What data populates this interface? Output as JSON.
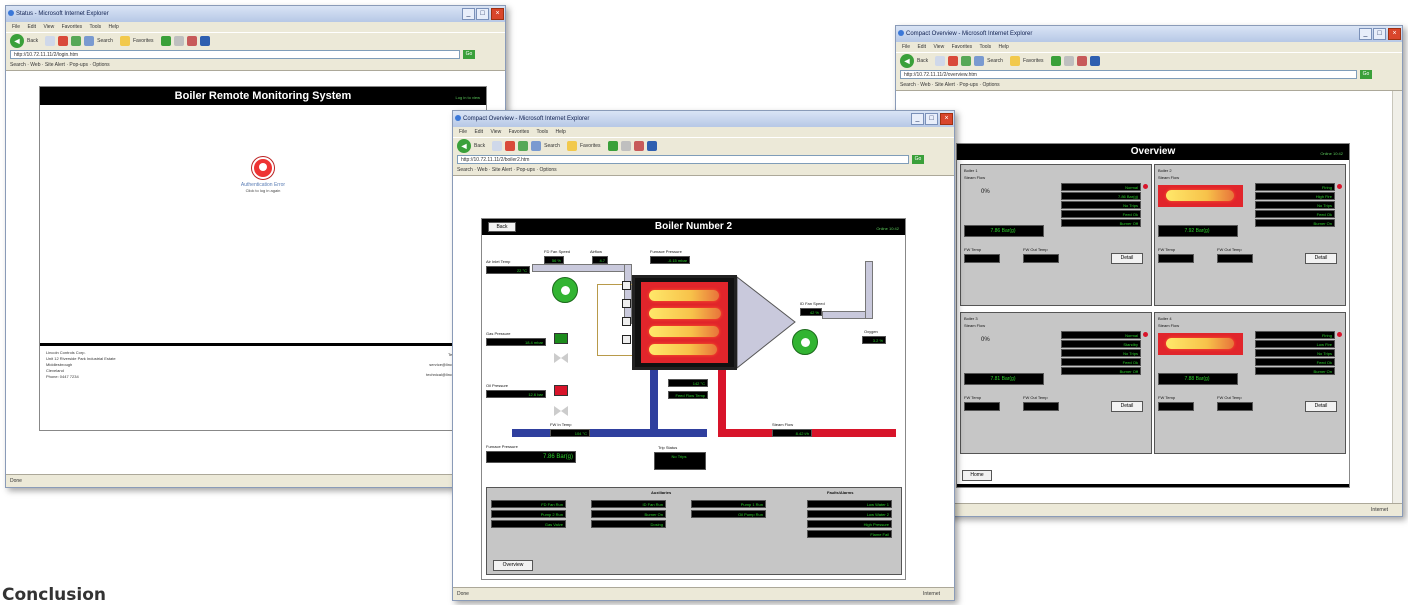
{
  "browser": {
    "menu": "File Edit View Favorites Tools Help",
    "back_label": "Back",
    "search_label": "Search",
    "favorites_label": "Favorites",
    "links_bar": "Search · Web · Site Alert · Pop-ups · Options",
    "status_ready": "Done",
    "status_zone": "Internet",
    "go_label": "Go"
  },
  "window1": {
    "title": "Status - Microsoft Internet Explorer",
    "address": "http://10.72.11.11/2/login.htm",
    "header": "Boiler Remote Monitoring System",
    "header_small": "Log in to view",
    "alert_main": "Authentication Error",
    "alert_sub": "Click to log in again",
    "footer_left": [
      "Lincoln Controls Corp.",
      "Unit 12 Riverside Park Industrial Estate",
      "Middlesbrough",
      "Cleveland",
      "Phone: 0447 7234"
    ],
    "footer_right": [
      "Tel: 0845 1234 567",
      "service@lincolncontrols.co.uk",
      "technical@lincolncontrols.co.uk"
    ]
  },
  "window2": {
    "title": "Compact Overview - Microsoft Internet Explorer",
    "address": "http://10.72.11.11/2/boiler2.htm",
    "header": "Boiler Number 2",
    "header_small": "Online 10:42",
    "back_btn": "Back",
    "labels": {
      "air_fan_speed": "FD Fan Speed",
      "airflow": "Airflow",
      "furnace_pressure": "Furnace Pressure",
      "id_fan_speed": "ID Fan Speed",
      "oxygen": "Oxygen",
      "gas_pressure": "Gas Pressure",
      "oil_pressure": "Oil Pressure",
      "air_inlet_temp": "Air Inlet Temp",
      "ff_in_temp": "FW In Temp",
      "ff_out_temp": "FW Out Temp",
      "steam_flow": "Steam Flow",
      "trip_status": "Trip Status",
      "aux_label": "Auxiliaries",
      "faults_label": "Faults/Alarms",
      "feed_flow_temp": "Feed Flow Temp"
    },
    "values": {
      "air_fan_speed": "56 %",
      "airflow": "4.7",
      "furnace_pressure": "-0.15 mbar",
      "id_fan_speed": "42 %",
      "oxygen": "3.2 %",
      "gas_pressure": "18.4 mbar",
      "oil_pressure": "12.6 bar",
      "air_inlet": "22 °C",
      "fw_in": "104 °C",
      "fw_out": "142 °C",
      "steam_flow": "8.42 t/h",
      "press_display": "7.86 Bar(g)",
      "trip_status": "No Trips"
    },
    "aux_rows": [
      "FD Fan Run",
      "ID Fan Run",
      "Pump 1 Run",
      "Pump 2 Run",
      "Burner On",
      "Oil Pump Run",
      "Gas Valve",
      "Dosing"
    ],
    "fault_rows": [
      "Low Water 1",
      "Low Water 2",
      "High Pressure",
      "Flame Fail"
    ],
    "overview_btn": "Overview"
  },
  "window3": {
    "title": "Compact Overview - Microsoft Internet Explorer",
    "address": "http://10.72.11.11/2/overview.htm",
    "header": "Overview",
    "header_small": "Online 10:42",
    "panels": [
      {
        "name": "Boiler 1",
        "status": "Steam Flow",
        "value_big": "0%",
        "fire": false,
        "lcd": [
          "Normal",
          "7.86 Bar(g)",
          "No Trips",
          "Feed Ok",
          "Burner Off"
        ],
        "press": "7.86 Bar(g)",
        "detail_btn": "Detail",
        "fw_in": "FW Temp",
        "fw_out": "FW Out Temp"
      },
      {
        "name": "Boiler 2",
        "status": "Steam Flow",
        "value_big": "",
        "fire": true,
        "lcd": [
          "Firing",
          "High Fire",
          "No Trips",
          "Feed Ok",
          "Burner On"
        ],
        "press": "7.92 Bar(g)",
        "detail_btn": "Detail",
        "fw_in": "FW Temp",
        "fw_out": "FW Out Temp"
      },
      {
        "name": "Boiler 3",
        "status": "Steam Flow",
        "value_big": "0%",
        "fire": false,
        "lcd": [
          "Normal",
          "Standby",
          "No Trips",
          "Feed Ok",
          "Burner Off"
        ],
        "press": "7.81 Bar(g)",
        "detail_btn": "Detail",
        "fw_in": "FW Temp",
        "fw_out": "FW Out Temp"
      },
      {
        "name": "Boiler 4",
        "status": "Steam Flow",
        "value_big": "",
        "fire": true,
        "lcd": [
          "Firing",
          "Low Fire",
          "No Trips",
          "Feed Ok",
          "Burner On"
        ],
        "press": "7.88 Bar(g)",
        "detail_btn": "Detail",
        "fw_in": "FW Temp",
        "fw_out": "FW Out Temp"
      }
    ],
    "bottom_btn": "Home"
  },
  "conclusion": "Conclusion",
  "colors": {
    "lcd_text": "#2bd12b",
    "fire_red": "#e1252b",
    "flame_yellow": "#ffe86a",
    "fan_green": "#32b432",
    "pipe_blue": "#2f3f9e",
    "pipe_red": "#d8142a",
    "panel_grey": "#c6c6c6"
  }
}
